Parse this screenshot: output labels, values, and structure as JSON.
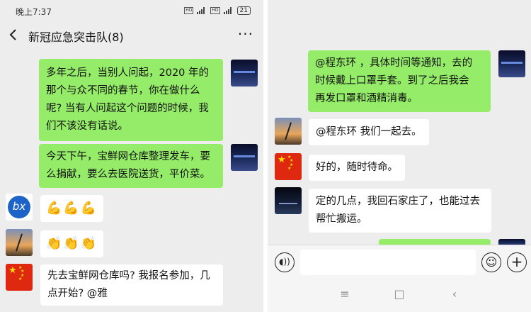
{
  "left": {
    "status": {
      "time": "晚上7:37",
      "signal_label": "4G",
      "hd": "HD",
      "battery": "21"
    },
    "nav": {
      "title": "新冠应急突击队(8)",
      "more": "···"
    },
    "messages": [
      {
        "text": "多年之后，当别人问起，2020 年的\n那个与众不同的春节，你在做什么\n呢? 当有人问起这个问题的时候，我\n们不该没有话说。"
      },
      {
        "text": "今天下午，宝鲜网仓库整理发车，要\n么捐献，要么去医院送货，平价菜。"
      },
      {
        "text": "💪💪💪"
      },
      {
        "text": "👏👏👏"
      },
      {
        "text": "先去宝鲜网仓库吗? 我报名参加，几\n点开始? @雅"
      }
    ]
  },
  "right": {
    "messages": [
      {
        "text": "@程东环 ，具体时间等通知，去的\n时候戴上口罩手套。到了之后我会\n再发口罩和酒精消毒。"
      },
      {
        "text": "@程东环  我们一起去。"
      },
      {
        "text": "好的，随时待命。"
      },
      {
        "text": "定的几点，我回石家庄了，也能过去\n帮忙搬运。"
      }
    ],
    "input": {
      "value": ""
    },
    "icons": {
      "voice": "voice-icon",
      "emoji": "emoji-icon",
      "plus": "plus-icon"
    },
    "sys_nav": {
      "menu": "≡",
      "home": "□",
      "back": "‹"
    }
  },
  "colors": {
    "my_bubble": "#95ec69",
    "other_bubble": "#ffffff",
    "background": "#ededed"
  }
}
